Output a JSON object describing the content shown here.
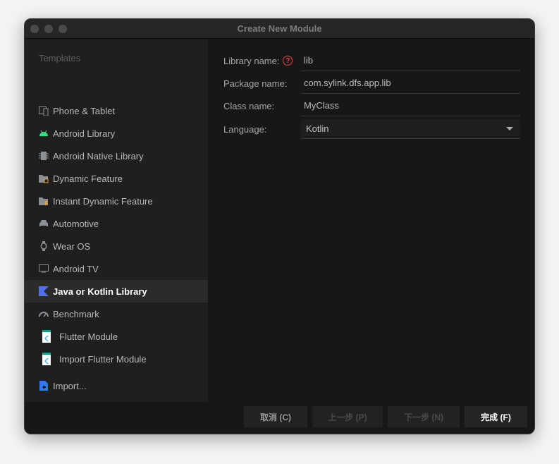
{
  "window": {
    "title": "Create New Module"
  },
  "sidebar": {
    "header": "Templates",
    "items": [
      {
        "label": "Phone & Tablet",
        "icon": "phone-tablet-icon"
      },
      {
        "label": "Android Library",
        "icon": "android-icon"
      },
      {
        "label": "Android Native Library",
        "icon": "chip-icon"
      },
      {
        "label": "Dynamic Feature",
        "icon": "folder-module-icon"
      },
      {
        "label": "Instant Dynamic Feature",
        "icon": "folder-instant-icon"
      },
      {
        "label": "Automotive",
        "icon": "car-icon"
      },
      {
        "label": "Wear OS",
        "icon": "watch-icon"
      },
      {
        "label": "Android TV",
        "icon": "tv-icon"
      },
      {
        "label": "Java or Kotlin Library",
        "icon": "kotlin-icon",
        "selected": true
      },
      {
        "label": "Benchmark",
        "icon": "gauge-icon"
      },
      {
        "label": "Flutter Module",
        "icon": "flutter-icon"
      },
      {
        "label": "Import Flutter Module",
        "icon": "flutter-icon"
      }
    ],
    "import": "Import..."
  },
  "form": {
    "library_name": {
      "label": "Library name:",
      "value": "lib"
    },
    "package_name": {
      "label": "Package name:",
      "value": "com.sylink.dfs.app.lib"
    },
    "class_name": {
      "label": "Class name:",
      "value": "MyClass"
    },
    "language": {
      "label": "Language:",
      "value": "Kotlin"
    }
  },
  "buttons": {
    "cancel": "取消 (C)",
    "previous": "上一步 (P)",
    "next": "下一步 (N)",
    "finish": "完成 (F)"
  },
  "colors": {
    "accent_error": "#e5474b",
    "android_green": "#3ddc84",
    "kotlin_blue": "#4f6ff0",
    "selected_bg": "#2b2b2b"
  }
}
